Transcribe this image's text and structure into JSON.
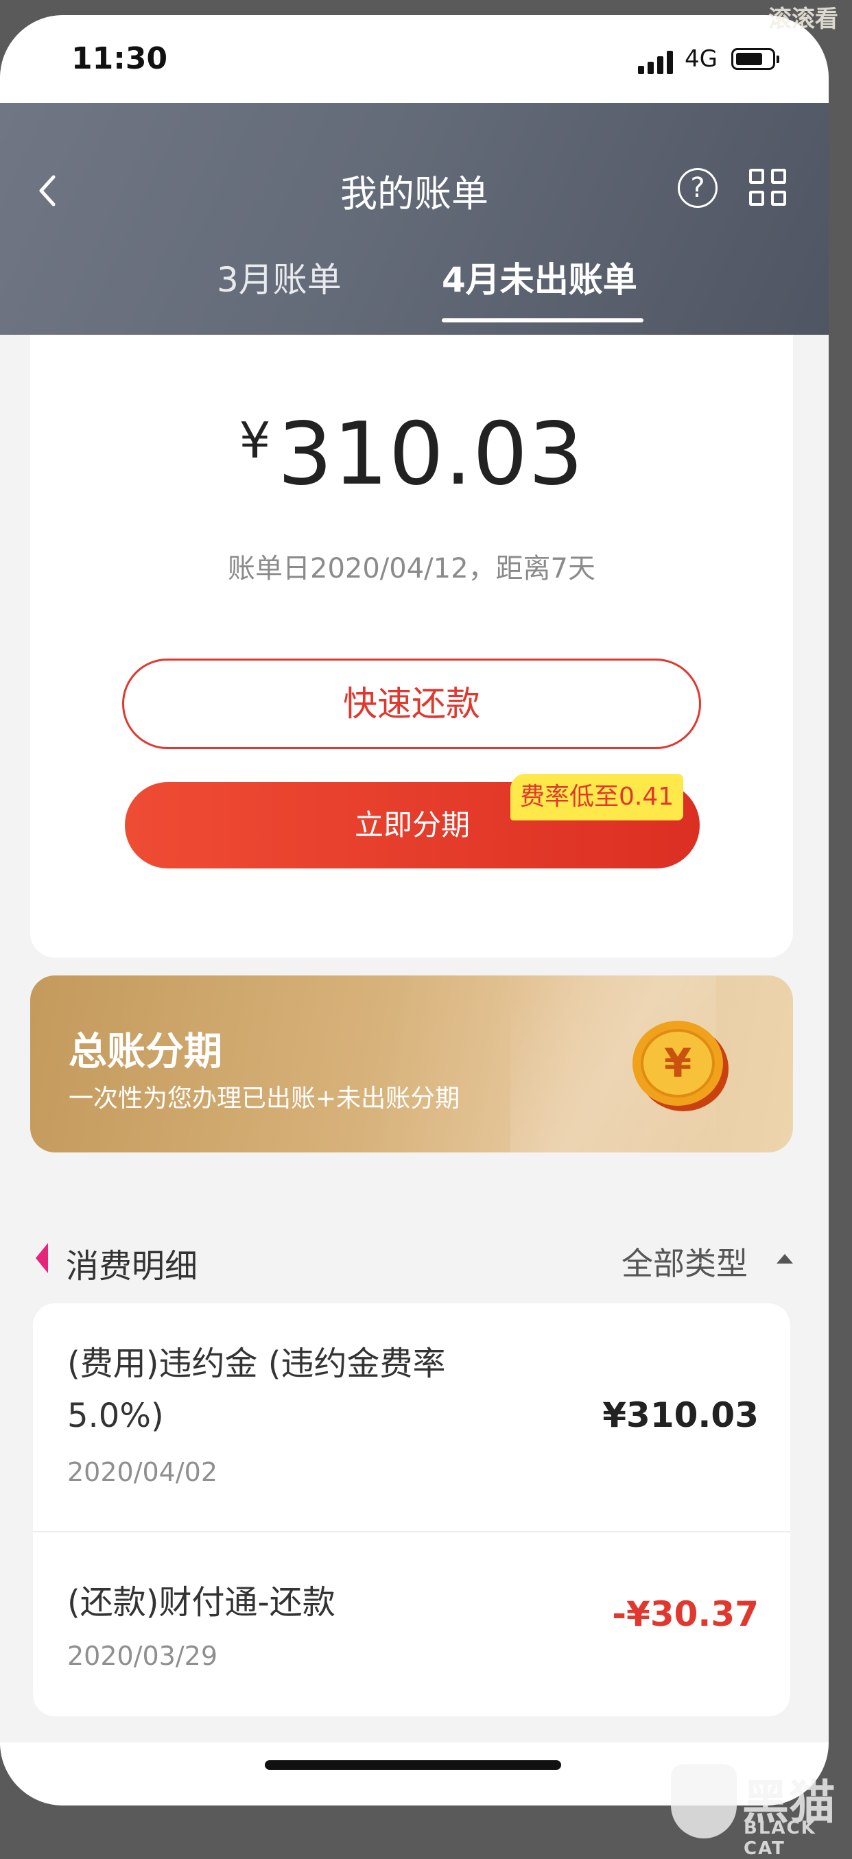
{
  "status_bar": {
    "time": "11:30",
    "network": "4G"
  },
  "header": {
    "title": "我的账单",
    "help_symbol": "?",
    "tabs": [
      {
        "label": "3月账单",
        "active": false
      },
      {
        "label": "4月未出账单",
        "active": true
      }
    ]
  },
  "bill_card": {
    "currency_symbol": "¥",
    "amount": "310.03",
    "bill_date_text": "账单日2020/04/12，距离7天",
    "quick_repay_label": "快速还款",
    "installment_label": "立即分期",
    "rate_badge": "费率低至0.41"
  },
  "promo_banner": {
    "title": "总账分期",
    "subtitle": "一次性为您办理已出账+未出账分期",
    "coin_symbol": "¥"
  },
  "details": {
    "section_title": "消费明细",
    "filter_label": "全部类型",
    "items": [
      {
        "description": "(费用)违约金 (违约金费率5.0%)",
        "date": "2020/04/02",
        "amount": "¥310.03"
      },
      {
        "description": "(还款)财付通-还款",
        "date": "2020/03/29",
        "amount": "-¥30.37"
      }
    ]
  },
  "watermarks": {
    "top_right": "滚滚看",
    "brand_cn": "黑猫",
    "brand_en": "BLACK CAT"
  },
  "colors": {
    "accent_red": "#e0382e",
    "header_gray": "#646b78",
    "badge_yellow": "#ffe84a",
    "banner_gold": "#d7b27a"
  }
}
